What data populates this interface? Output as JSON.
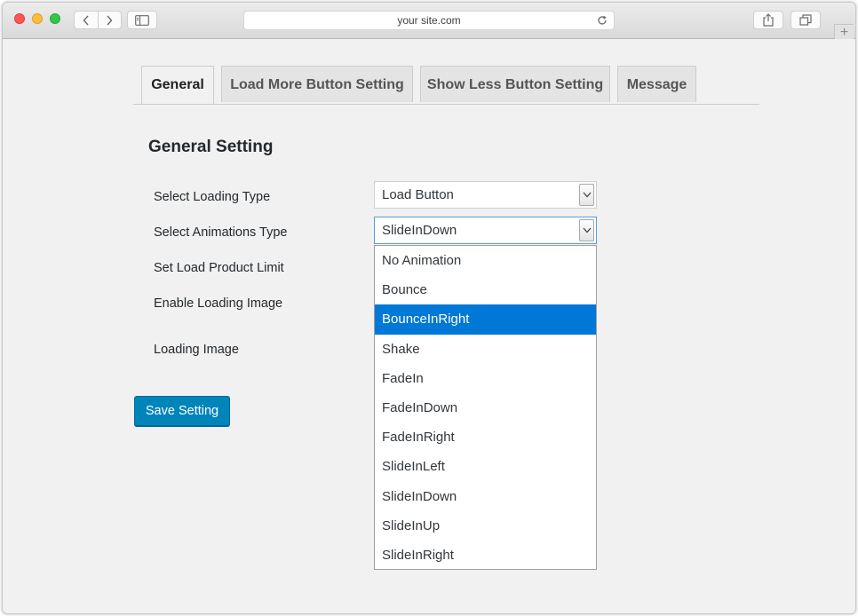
{
  "browser": {
    "url": "your site.com"
  },
  "tabs": [
    {
      "label": "General",
      "active": true
    },
    {
      "label": "Load More Button Setting",
      "active": false
    },
    {
      "label": "Show Less Button Setting",
      "active": false
    },
    {
      "label": "Message",
      "active": false
    }
  ],
  "section_title": "General Setting",
  "form": {
    "loading_type_label": "Select Loading Type",
    "loading_type_value": "Load Button",
    "animation_type_label": "Select Animations Type",
    "animation_type_value": "SlideInDown",
    "product_limit_label": "Set Load Product Limit",
    "enable_loading_image_label": "Enable Loading Image",
    "loading_image_label": "Loading Image"
  },
  "dropdown": {
    "options": [
      "No Animation",
      "Bounce",
      "BounceInRight",
      "Shake",
      "FadeIn",
      "FadeInDown",
      "FadeInRight",
      "SlideInLeft",
      "SlideInDown",
      "SlideInUp",
      "SlideInRight"
    ],
    "highlighted": "BounceInRight"
  },
  "save_button_label": "Save Setting",
  "colors": {
    "primary_button": "#0085ba",
    "dropdown_highlight": "#0078d7",
    "page_background": "#f1f1f1"
  }
}
